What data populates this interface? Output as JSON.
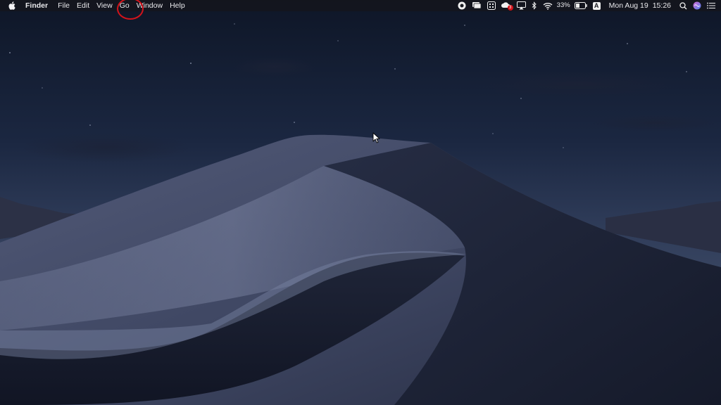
{
  "menubar": {
    "apple_icon": "apple-logo-icon",
    "app_name": "Finder",
    "menus": [
      "File",
      "Edit",
      "View",
      "Go",
      "Window",
      "Help"
    ],
    "highlighted_menu": "Go",
    "highlight_color": "#d3131b",
    "status": {
      "icons": [
        "screen-record-icon",
        "notifications-icon",
        "grid-app-icon",
        "adobe-cc-icon",
        "airplay-icon",
        "bluetooth-icon",
        "wifi-icon",
        "battery-icon",
        "input-source-icon",
        "spotlight-icon",
        "siri-icon",
        "notification-center-icon"
      ],
      "adobe_badge": "3",
      "battery_percent": "33%",
      "input_source": "A",
      "date": "Mon Aug 19",
      "time": "15:26"
    }
  },
  "desktop": {
    "wallpaper": "mojave-night-dunes",
    "colors": {
      "sky_top": "#0f1829",
      "sky_horizon": "#3d4a66",
      "dune_light": "#6f7897",
      "dune_dark": "#1a2032"
    }
  }
}
